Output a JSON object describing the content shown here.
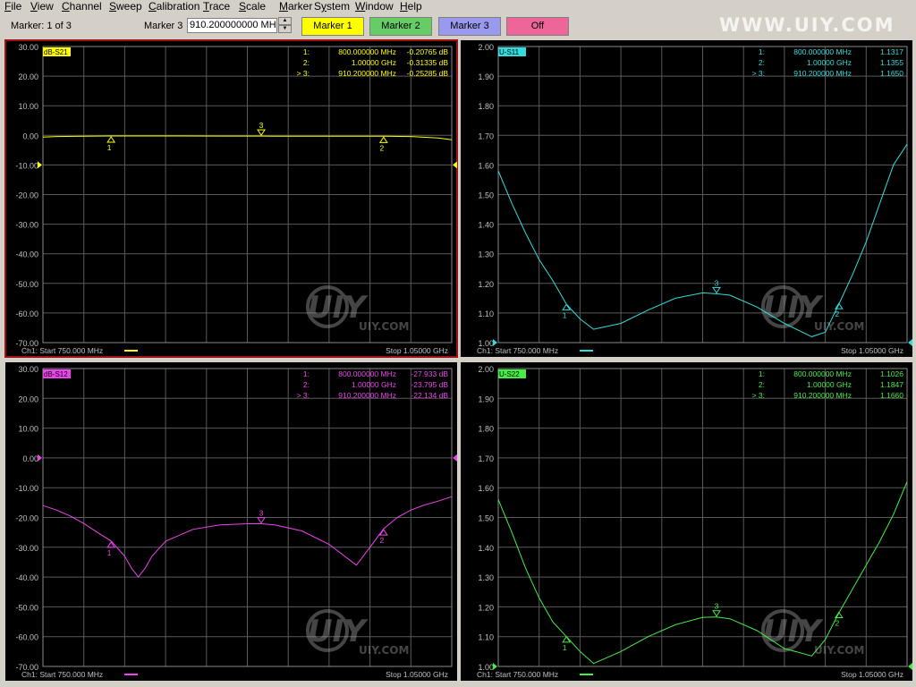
{
  "menu": [
    "File",
    "View",
    "Channel",
    "Sweep",
    "Calibration",
    "Trace",
    "Scale",
    "Marker",
    "System",
    "Window",
    "Help"
  ],
  "menu_underline": [
    "F",
    "V",
    "C",
    "S",
    "C",
    "T",
    "S",
    "M",
    "y",
    "W",
    "H"
  ],
  "toolbar": {
    "marker_count": "Marker: 1 of 3",
    "marker_label": "Marker 3",
    "marker_value": "910.200000000 MH",
    "buttons": [
      {
        "label": "Marker 1",
        "color": "#ffff00"
      },
      {
        "label": "Marker 2",
        "color": "#66cc66"
      },
      {
        "label": "Marker 3",
        "color": "#9999ee"
      },
      {
        "label": "Off",
        "color": "#ee6699"
      }
    ],
    "watermark": "WWW.UIY.COM"
  },
  "chart_data": [
    {
      "type": "line",
      "trace_label": "dB-S21",
      "color": "#ffff00",
      "ylim": [
        -70,
        30
      ],
      "yticks": [
        "30.00",
        "20.00",
        "10.00",
        "0.00",
        "-10.00",
        "-20.00",
        "-30.00",
        "-40.00",
        "-50.00",
        "-60.00",
        "-70.00"
      ],
      "xlim": [
        750,
        1050
      ],
      "x_unit": "MHz",
      "ref_value": -10,
      "series": [
        {
          "x": [
            750,
            760,
            780,
            800,
            820,
            850,
            880,
            900,
            910.2,
            920,
            940,
            960,
            980,
            1000,
            1020,
            1040,
            1050
          ],
          "y": [
            -0.6,
            -0.4,
            -0.3,
            -0.21,
            -0.2,
            -0.22,
            -0.24,
            -0.25,
            -0.253,
            -0.26,
            -0.28,
            -0.3,
            -0.31,
            -0.31,
            -0.4,
            -0.9,
            -1.5
          ]
        }
      ],
      "markers": [
        {
          "id": "1",
          "x": 800,
          "y": -0.20765
        },
        {
          "id": "2",
          "x": 1000,
          "y": -0.31335
        },
        {
          "id": "3",
          "x": 910.2,
          "y": -0.25285
        }
      ],
      "marker_table": [
        {
          "idx": "1:",
          "freq": "800.000000 MHz",
          "val": "-0.20765 dB"
        },
        {
          "idx": "2:",
          "freq": "1.00000 GHz",
          "val": "-0.31335 dB"
        },
        {
          "idx": "> 3:",
          "freq": "910.200000 MHz",
          "val": "-0.25285 dB"
        }
      ],
      "footer_start": "Ch1: Start  750.000 MHz",
      "footer_stop": "Stop  1.05000 GHz"
    },
    {
      "type": "line",
      "trace_label": "U-S11",
      "color": "#33dddd",
      "ylim": [
        1.0,
        2.0
      ],
      "yticks": [
        "2.00",
        "1.90",
        "1.80",
        "1.70",
        "1.60",
        "1.50",
        "1.40",
        "1.30",
        "1.20",
        "1.10",
        "1.00"
      ],
      "xlim": [
        750,
        1050
      ],
      "x_unit": "MHz",
      "ref_value": 1.0,
      "series": [
        {
          "x": [
            750,
            760,
            770,
            780,
            790,
            800,
            810,
            820,
            840,
            860,
            880,
            900,
            910.2,
            920,
            940,
            960,
            980,
            990,
            1000,
            1010,
            1020,
            1030,
            1040,
            1050
          ],
          "y": [
            1.58,
            1.47,
            1.37,
            1.28,
            1.21,
            1.13,
            1.08,
            1.045,
            1.065,
            1.11,
            1.15,
            1.168,
            1.165,
            1.16,
            1.12,
            1.065,
            1.02,
            1.035,
            1.13,
            1.23,
            1.34,
            1.47,
            1.6,
            1.67
          ]
        }
      ],
      "markers": [
        {
          "id": "1",
          "x": 800,
          "y": 1.1317
        },
        {
          "id": "2",
          "x": 1000,
          "y": 1.1355
        },
        {
          "id": "3",
          "x": 910.2,
          "y": 1.165
        }
      ],
      "marker_table": [
        {
          "idx": "1:",
          "freq": "800.000000 MHz",
          "val": "1.1317"
        },
        {
          "idx": "2:",
          "freq": "1.00000 GHz",
          "val": "1.1355"
        },
        {
          "idx": "> 3:",
          "freq": "910.200000 MHz",
          "val": "1.1650"
        }
      ],
      "footer_start": "Ch1: Start  750.000 MHz",
      "footer_stop": "Stop  1.05000 GHz"
    },
    {
      "type": "line",
      "trace_label": "dB-S12",
      "color": "#ee44ee",
      "ylim": [
        -70,
        30
      ],
      "yticks": [
        "30.00",
        "20.00",
        "10.00",
        "0.00",
        "-10.00",
        "-20.00",
        "-30.00",
        "-40.00",
        "-50.00",
        "-60.00",
        "-70.00"
      ],
      "xlim": [
        750,
        1050
      ],
      "x_unit": "MHz",
      "ref_value": 0,
      "series": [
        {
          "x": [
            750,
            760,
            770,
            780,
            790,
            800,
            810,
            815,
            820,
            825,
            830,
            840,
            860,
            880,
            900,
            910.2,
            920,
            940,
            960,
            970,
            980,
            990,
            1000,
            1010,
            1020,
            1030,
            1040,
            1050
          ],
          "y": [
            -16,
            -17.5,
            -19.5,
            -22,
            -25,
            -27.9,
            -33,
            -37,
            -40,
            -37,
            -33,
            -28,
            -24,
            -22.5,
            -22.1,
            -22.1,
            -22.5,
            -24.5,
            -29,
            -32.5,
            -36,
            -30,
            -23.8,
            -20,
            -17.5,
            -15.8,
            -14.5,
            -13
          ]
        }
      ],
      "markers": [
        {
          "id": "1",
          "x": 800,
          "y": -27.933
        },
        {
          "id": "2",
          "x": 1000,
          "y": -23.795
        },
        {
          "id": "3",
          "x": 910.2,
          "y": -22.134
        }
      ],
      "marker_table": [
        {
          "idx": "1:",
          "freq": "800.000000 MHz",
          "val": "-27.933 dB"
        },
        {
          "idx": "2:",
          "freq": "1.00000 GHz",
          "val": "-23.795 dB"
        },
        {
          "idx": "> 3:",
          "freq": "910.200000 MHz",
          "val": "-22.134 dB"
        }
      ],
      "footer_start": "Ch1: Start  750.000 MHz",
      "footer_stop": "Stop  1.05000 GHz"
    },
    {
      "type": "line",
      "trace_label": "U-S22",
      "color": "#44ee44",
      "ylim": [
        1.0,
        2.0
      ],
      "yticks": [
        "2.00",
        "1.90",
        "1.80",
        "1.70",
        "1.60",
        "1.50",
        "1.40",
        "1.30",
        "1.20",
        "1.10",
        "1.00"
      ],
      "xlim": [
        750,
        1050
      ],
      "x_unit": "MHz",
      "ref_value": 1.0,
      "series": [
        {
          "x": [
            750,
            760,
            770,
            780,
            790,
            800,
            810,
            820,
            840,
            860,
            880,
            900,
            910.2,
            920,
            940,
            960,
            980,
            990,
            1000,
            1010,
            1020,
            1030,
            1040,
            1050
          ],
          "y": [
            1.56,
            1.45,
            1.33,
            1.23,
            1.15,
            1.1,
            1.05,
            1.01,
            1.05,
            1.1,
            1.14,
            1.165,
            1.166,
            1.16,
            1.12,
            1.06,
            1.035,
            1.09,
            1.18,
            1.26,
            1.34,
            1.42,
            1.51,
            1.62
          ]
        }
      ],
      "markers": [
        {
          "id": "1",
          "x": 800,
          "y": 1.1026
        },
        {
          "id": "2",
          "x": 1000,
          "y": 1.1847
        },
        {
          "id": "3",
          "x": 910.2,
          "y": 1.166
        }
      ],
      "marker_table": [
        {
          "idx": "1:",
          "freq": "800.000000 MHz",
          "val": "1.1026"
        },
        {
          "idx": "2:",
          "freq": "1.00000 GHz",
          "val": "1.1847"
        },
        {
          "idx": "> 3:",
          "freq": "910.200000 MHz",
          "val": "1.1660"
        }
      ],
      "footer_start": "Ch1: Start  750.000 MHz",
      "footer_stop": "Stop  1.05000 GHz"
    }
  ]
}
